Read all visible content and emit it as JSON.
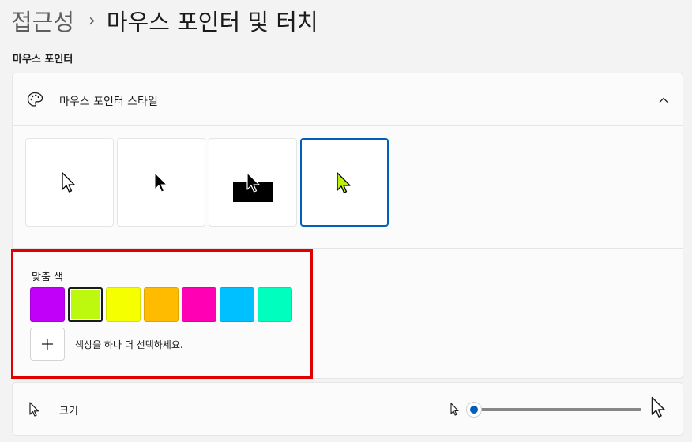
{
  "breadcrumb": {
    "parent": "접근성",
    "separator": "›",
    "current": "마우스 포인터 및 터치"
  },
  "section": {
    "title": "마우스 포인터"
  },
  "pointer_style": {
    "label": "마우스 포인터 스타일",
    "icon": "palette-icon",
    "expanded": true,
    "tiles": [
      {
        "name": "white-pointer",
        "selected": false
      },
      {
        "name": "black-pointer",
        "selected": false
      },
      {
        "name": "inverted-pointer",
        "selected": false
      },
      {
        "name": "custom-pointer",
        "selected": true,
        "color": "#b9f10c"
      }
    ]
  },
  "custom_color": {
    "label": "맞춤 색",
    "swatches": [
      {
        "color": "#c000f8",
        "selected": false
      },
      {
        "color": "#bdf80f",
        "selected": true
      },
      {
        "color": "#f5ff00",
        "selected": false
      },
      {
        "color": "#ffbb00",
        "selected": false
      },
      {
        "color": "#ff00b4",
        "selected": false
      },
      {
        "color": "#00c0ff",
        "selected": false
      },
      {
        "color": "#00ffbf",
        "selected": false
      }
    ],
    "add_label": "색상을 하나 더 선택하세요."
  },
  "size": {
    "label": "크기",
    "icon": "pointer-icon",
    "value": 1,
    "min": 1,
    "max": 15
  },
  "colors": {
    "accent": "#005fb8",
    "highlight": "#e00000"
  }
}
